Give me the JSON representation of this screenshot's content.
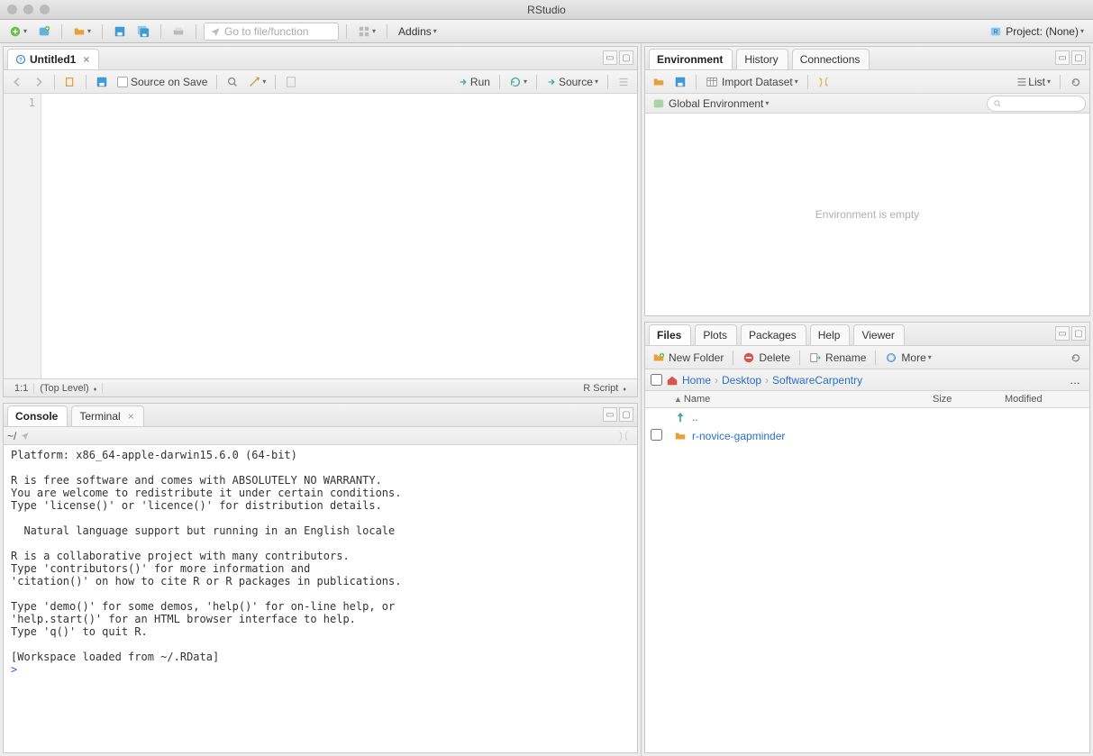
{
  "window_title": "RStudio",
  "main_toolbar": {
    "goto_placeholder": "Go to file/function",
    "addins": "Addins",
    "project_label": "Project: (None)"
  },
  "editor": {
    "tab_title": "Untitled1",
    "source_on_save": "Source on Save",
    "run": "Run",
    "source": "Source",
    "line1": "1",
    "statusbar": {
      "pos": "1:1",
      "scope": "(Top Level)",
      "type": "R Script"
    }
  },
  "console": {
    "tab_console": "Console",
    "tab_terminal": "Terminal",
    "path": "~/",
    "text": "Platform: x86_64-apple-darwin15.6.0 (64-bit)\n\nR is free software and comes with ABSOLUTELY NO WARRANTY.\nYou are welcome to redistribute it under certain conditions.\nType 'license()' or 'licence()' for distribution details.\n\n  Natural language support but running in an English locale\n\nR is a collaborative project with many contributors.\nType 'contributors()' for more information and\n'citation()' on how to cite R or R packages in publications.\n\nType 'demo()' for some demos, 'help()' for on-line help, or\n'help.start()' for an HTML browser interface to help.\nType 'q()' to quit R.\n\n[Workspace loaded from ~/.RData]\n",
    "prompt": ">"
  },
  "environment": {
    "tab_env": "Environment",
    "tab_hist": "History",
    "tab_conn": "Connections",
    "import": "Import Dataset",
    "list": "List",
    "global_env": "Global Environment",
    "empty_msg": "Environment is empty"
  },
  "files": {
    "tab_files": "Files",
    "tab_plots": "Plots",
    "tab_packages": "Packages",
    "tab_help": "Help",
    "tab_viewer": "Viewer",
    "new_folder": "New Folder",
    "delete": "Delete",
    "rename": "Rename",
    "more": "More",
    "breadcrumb": {
      "home": "Home",
      "desktop": "Desktop",
      "folder": "SoftwareCarpentry"
    },
    "headers": {
      "name": "Name",
      "size": "Size",
      "modified": "Modified"
    },
    "updir": "..",
    "items": [
      {
        "name": "r-novice-gapminder"
      }
    ]
  }
}
